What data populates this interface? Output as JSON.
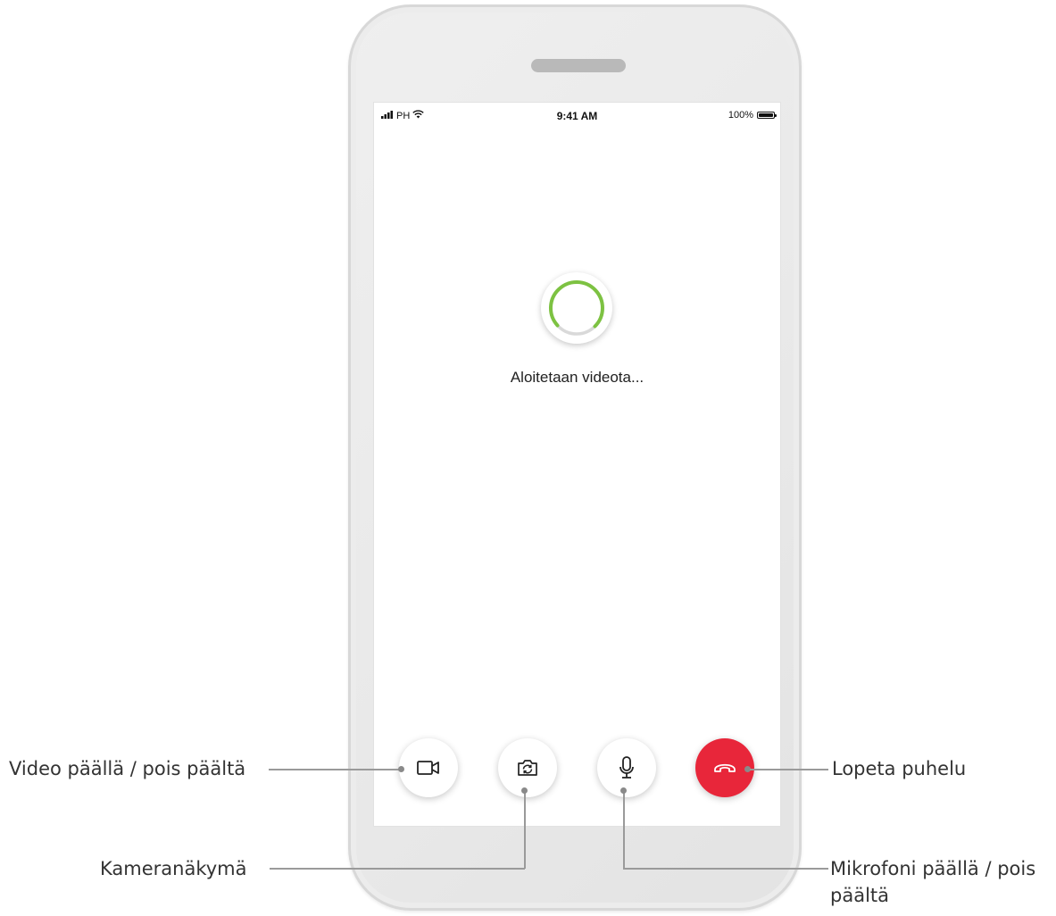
{
  "status_bar": {
    "carrier": "PH",
    "time": "9:41 AM",
    "battery": "100%"
  },
  "screen": {
    "loading_text": "Aloitetaan videota..."
  },
  "buttons": {
    "video_icon": "video-camera-icon",
    "camera_icon": "camera-switch-icon",
    "mic_icon": "microphone-icon",
    "end_icon": "phone-hangup-icon",
    "end_color": "#e8263a"
  },
  "callouts": {
    "video": "Video päällä / pois päältä",
    "camera": "Kameranäkymä",
    "mic_line1": "Mikrofoni päällä / pois",
    "mic_line2": "päältä",
    "end": "Lopeta puhelu"
  },
  "colors": {
    "spinner_accent": "#7dc242",
    "spinner_track": "#d9d9d9"
  }
}
